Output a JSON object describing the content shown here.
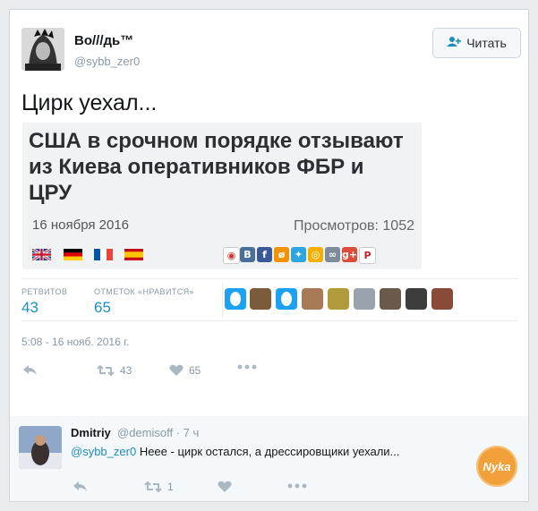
{
  "tweet": {
    "author_name": "Во///дь™",
    "author_handle": "@sybb_zer0",
    "follow_label": "Читать",
    "text": "Цирк уехал...",
    "quote": {
      "headline": "США в срочном порядке отзывают из Киева оперативников ФБР и ЦРУ",
      "date": "16 ноября 2016",
      "views": "Просмотров: 1052",
      "flags": [
        "gb-flag",
        "de-flag",
        "fr-flag",
        "es-flag"
      ],
      "share_icons": [
        "pocket-icon",
        "vk-icon",
        "facebook-icon",
        "odnoklassniki-icon",
        "twitter-icon",
        "livejournal-icon",
        "link-icon",
        "google-plus-icon",
        "pinterest-icon"
      ]
    },
    "retweets_label": "РЕТВИТОВ",
    "retweets_count": "43",
    "likes_label": "ОТМЕТОК «НРАВИТСЯ»",
    "likes_count": "65",
    "timestamp": "5:08 - 16 нояб. 2016 г.",
    "actions": {
      "retweet_count": "43",
      "like_count": "65"
    }
  },
  "reply": {
    "author_name": "Dmitriy",
    "author_handle_time": "@demisoff · 7 ч",
    "mention": "@sybb_zer0",
    "text": "Нееe - цирк остался, а дрессировщики уехали...",
    "actions": {
      "retweet_count": "1"
    }
  },
  "badge_text": "Nyka",
  "colors": {
    "accent": "#1d8dc0",
    "muted": "#8899a6",
    "background": "#e9ecee"
  }
}
